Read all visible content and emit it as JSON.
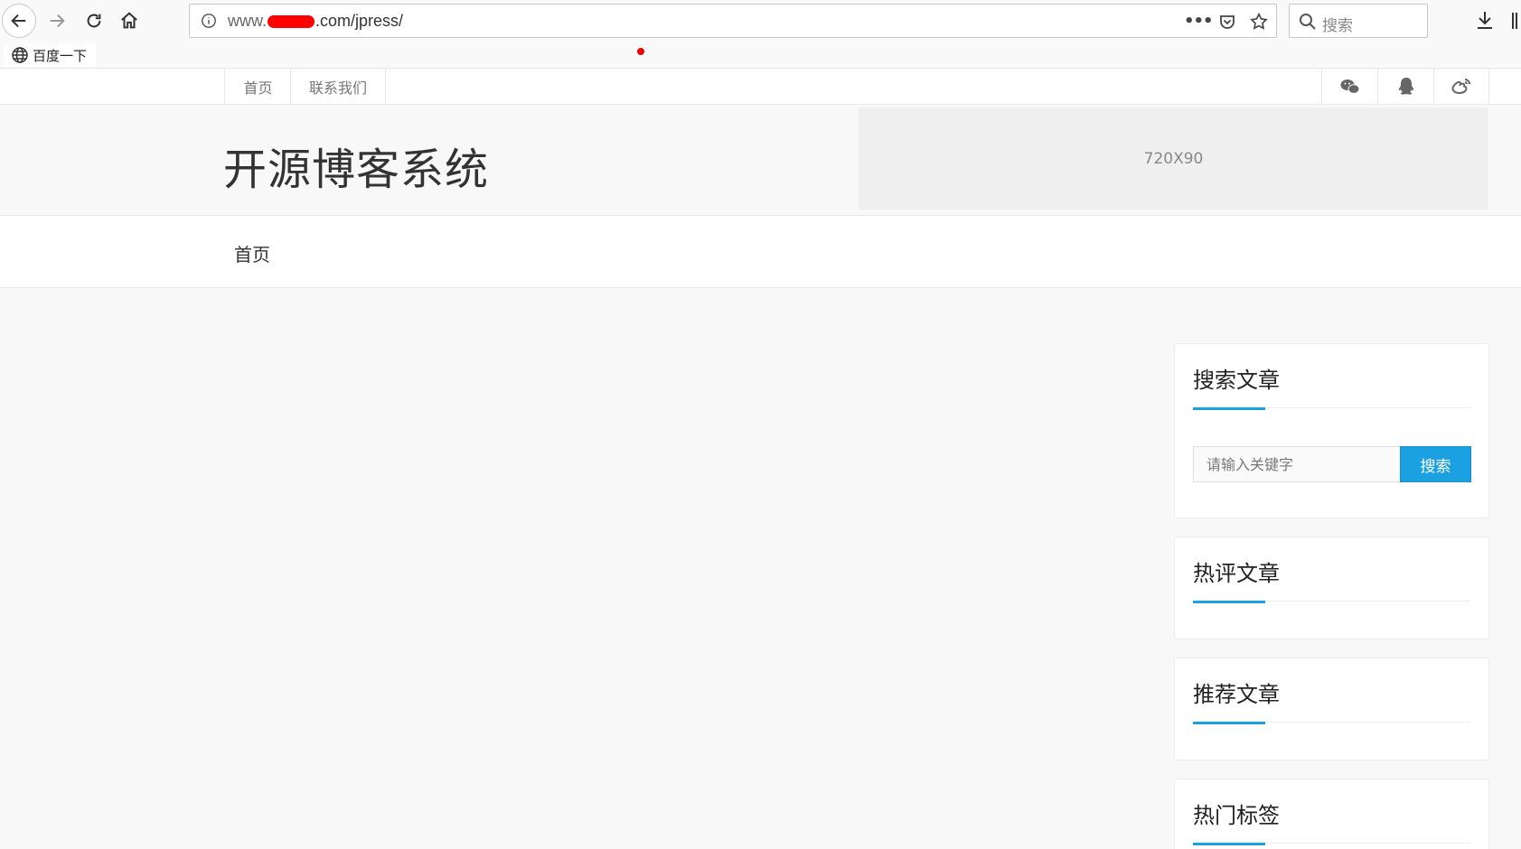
{
  "browser": {
    "url_prefix": "www.",
    "url_suffix": ".com/jpress/",
    "search_placeholder": "搜索",
    "bookmark_label": "百度一下"
  },
  "topnav": {
    "items": [
      {
        "label": "首页"
      },
      {
        "label": "联系我们"
      }
    ],
    "social_icons": [
      "wechat-icon",
      "qq-icon",
      "weibo-icon"
    ]
  },
  "header": {
    "site_title": "开源博客系统",
    "ad_label": "720X90"
  },
  "main_nav": {
    "home_label": "首页"
  },
  "sidebar": {
    "search": {
      "title": "搜索文章",
      "placeholder": "请输入关键字",
      "button_label": "搜索"
    },
    "hot_comments": {
      "title": "热评文章"
    },
    "recommended": {
      "title": "推荐文章"
    },
    "hot_tags": {
      "title": "热门标签"
    }
  },
  "colors": {
    "accent": "#1ba1e2",
    "background": "#f8f8f8"
  }
}
